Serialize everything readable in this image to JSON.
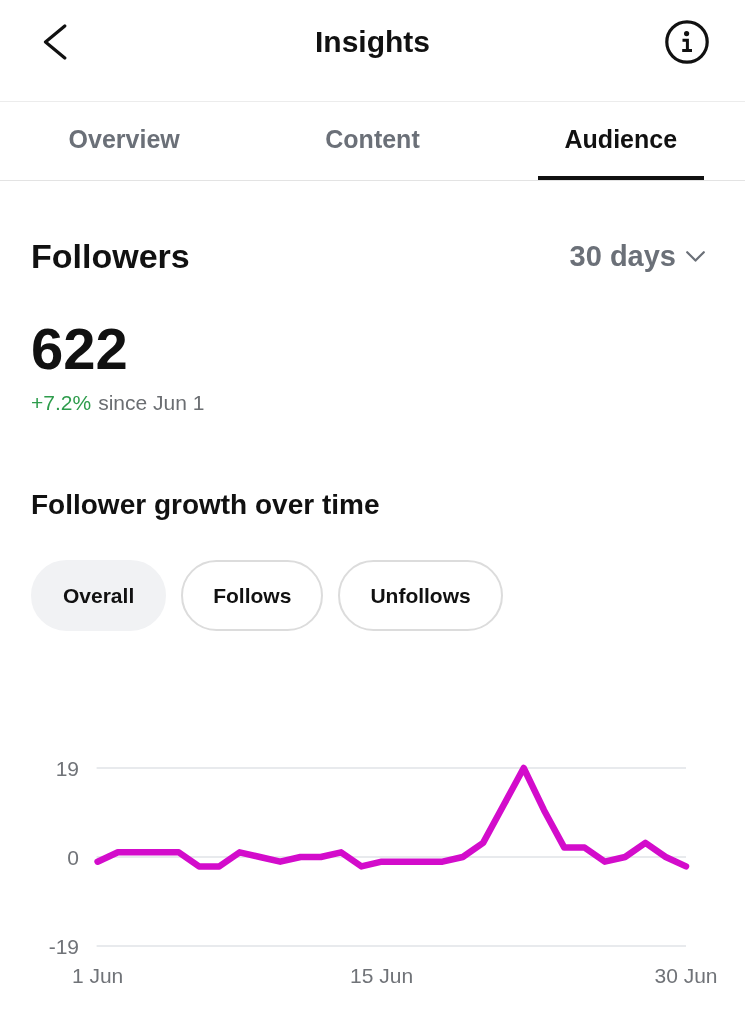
{
  "header": {
    "title": "Insights"
  },
  "tabs": [
    {
      "label": "Overview",
      "selected": false
    },
    {
      "label": "Content",
      "selected": false
    },
    {
      "label": "Audience",
      "selected": true
    }
  ],
  "followers": {
    "title": "Followers",
    "period": "30 days",
    "count": "622",
    "change": "+7.2%",
    "since": "since Jun 1"
  },
  "growth": {
    "title": "Follower growth over time",
    "filters": [
      {
        "label": "Overall",
        "selected": true
      },
      {
        "label": "Follows",
        "selected": false
      },
      {
        "label": "Unfollows",
        "selected": false
      }
    ],
    "chart_data": {
      "type": "line",
      "categories": [
        "1 Jun",
        null,
        null,
        null,
        null,
        null,
        null,
        null,
        null,
        null,
        null,
        null,
        null,
        null,
        "15 Jun",
        null,
        null,
        null,
        null,
        null,
        null,
        null,
        null,
        null,
        null,
        null,
        null,
        null,
        null,
        "30 Jun"
      ],
      "values": [
        -1,
        1,
        1,
        1,
        1,
        -2,
        -2,
        1,
        0,
        -1,
        0,
        0,
        1,
        -2,
        -1,
        -1,
        -1,
        -1,
        0,
        3,
        11,
        19,
        10,
        2,
        2,
        -1,
        0,
        3,
        0,
        -2
      ],
      "ylim": [
        -19,
        19
      ],
      "yticks": [
        19,
        0,
        -19
      ]
    }
  }
}
